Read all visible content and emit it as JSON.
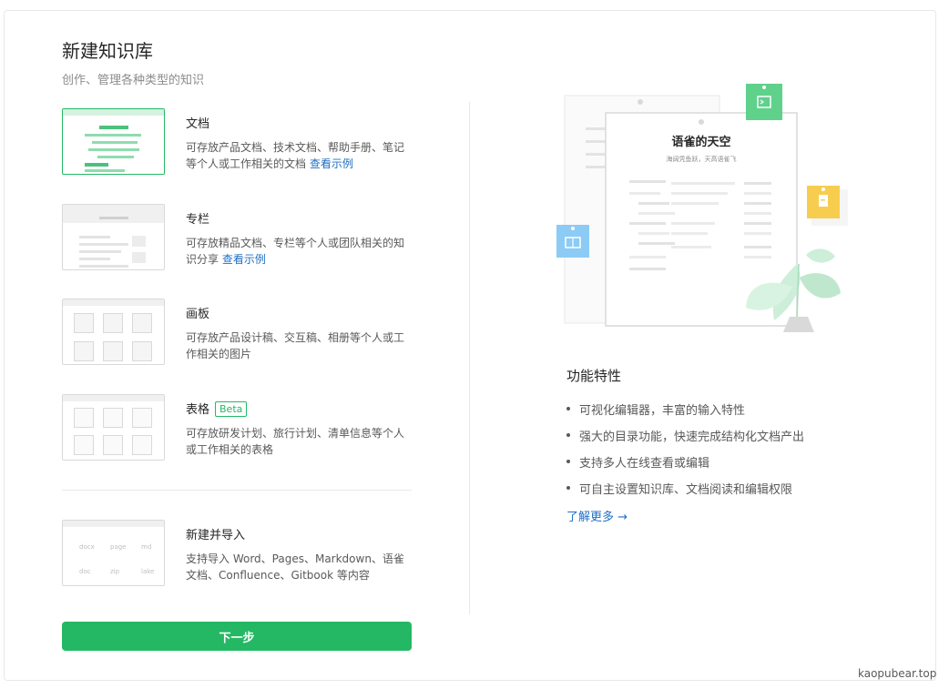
{
  "header": {
    "title": "新建知识库",
    "subtitle": "创作、管理各种类型的知识"
  },
  "types": [
    {
      "title": "文档",
      "desc": "可存放产品文档、技术文档、帮助手册、笔记等个人或工作相关的文档",
      "link": "查看示例",
      "selected": true
    },
    {
      "title": "专栏",
      "desc": "可存放精品文档、专栏等个人或团队相关的知识分享",
      "link": "查看示例"
    },
    {
      "title": "画板",
      "desc": "可存放产品设计稿、交互稿、相册等个人或工作相关的图片"
    },
    {
      "title": "表格",
      "badge": "Beta",
      "desc": "可存放研发计划、旅行计划、清单信息等个人或工作相关的表格"
    },
    {
      "title": "新建并导入",
      "desc": "支持导入 Word、Pages、Markdown、语雀文档、Confluence、Gitbook 等内容"
    }
  ],
  "import_formats": [
    "docx",
    "page",
    "md",
    "doc",
    "zip",
    "lake"
  ],
  "next_button": "下一步",
  "illustration": {
    "doc_title": "语雀的天空",
    "doc_subtitle": "海阔凭鱼跃，天高语雀飞",
    "icons": [
      "terminal-icon",
      "document-icon",
      "book-icon",
      "plant-icon"
    ]
  },
  "features": {
    "title": "功能特性",
    "items": [
      "可视化编辑器，丰富的输入特性",
      "强大的目录功能，快速完成结构化文档产出",
      "支持多人在线查看或编辑",
      "可自主设置知识库、文档阅读和编辑权限"
    ],
    "learn_more": "了解更多 →"
  },
  "watermark": "kaopubear.top",
  "colors": {
    "primary": "#25b864",
    "link": "#1f6fc5",
    "blue_note": "#8ccbf5",
    "yellow_note": "#f7cd4f"
  }
}
